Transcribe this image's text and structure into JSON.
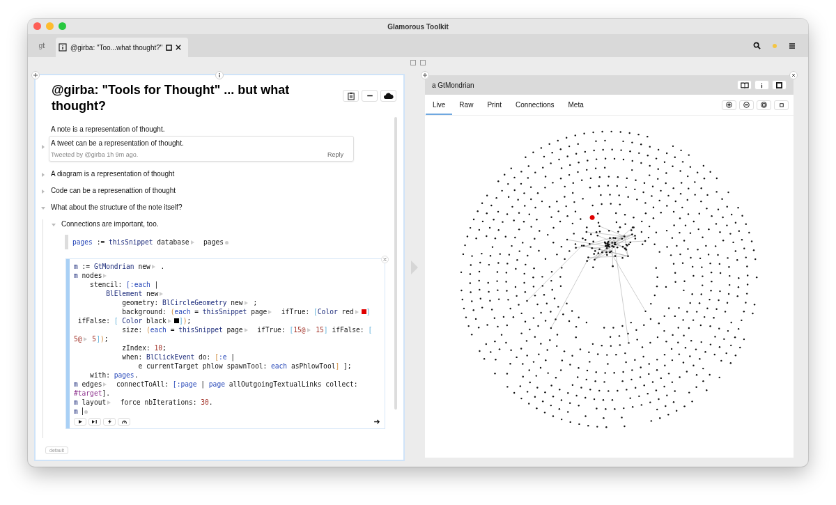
{
  "window": {
    "title": "Glamorous Toolkit"
  },
  "tabbar": {
    "logo": "g**t**",
    "tabs": [
      {
        "label": "@girba: \"Too...what thought?\"",
        "selected": true
      }
    ]
  },
  "note": {
    "title": "@girba: \"Tools for Thought\" ... but what thought?",
    "items": [
      {
        "kind": "text",
        "text": "A note is a representation of thought."
      },
      {
        "kind": "tweet",
        "text": "A tweet can be a representation of thought.",
        "meta": "Tweeted by @girba  1h 9m ago.",
        "action": "Reply",
        "expanded": false
      },
      {
        "kind": "text",
        "text": "A diagram is a representation of thought",
        "expanded": false
      },
      {
        "kind": "text",
        "text": "Code can be a represenattion of thought",
        "expanded": false
      },
      {
        "kind": "text",
        "text": "What about the structure of the note itself?",
        "expanded": true,
        "children": [
          {
            "kind": "text",
            "text": "Connections are important, too.",
            "expanded": true,
            "children": [
              {
                "kind": "code",
                "focused": false,
                "lines": [
                  [
                    {
                      "t": "pages",
                      "kind": "arg"
                    },
                    {
                      "t": " := ",
                      "kind": "plain"
                    },
                    {
                      "t": "thisSnippet",
                      "kind": "cls"
                    },
                    {
                      "t": " database",
                      "kind": "plain"
                    },
                    {
                      "kind": "exp"
                    },
                    {
                      "t": "  pages",
                      "kind": "plain"
                    },
                    {
                      "kind": "dot"
                    }
                  ]
                ]
              },
              {
                "kind": "code",
                "focused": true,
                "lines": [
                  [
                    {
                      "t": "m",
                      "kind": "cls"
                    },
                    {
                      "t": " := ",
                      "kind": "plain"
                    },
                    {
                      "t": "GtMondrian",
                      "kind": "cls"
                    },
                    {
                      "t": " new",
                      "kind": "plain"
                    },
                    {
                      "kind": "exp"
                    },
                    {
                      "t": " .",
                      "kind": "plain"
                    }
                  ],
                  [
                    {
                      "t": "m",
                      "kind": "cls"
                    },
                    {
                      "t": " nodes",
                      "kind": "plain"
                    },
                    {
                      "kind": "exp"
                    }
                  ],
                  [
                    {
                      "t": "    stencil: ",
                      "kind": "plain"
                    },
                    {
                      "t": "[:each",
                      "kind": "arg"
                    },
                    {
                      "t": " |",
                      "kind": "plain"
                    }
                  ],
                  [
                    {
                      "t": "        BlElement",
                      "kind": "cls"
                    },
                    {
                      "t": " new",
                      "kind": "plain"
                    },
                    {
                      "kind": "exp"
                    }
                  ],
                  [
                    {
                      "t": "            geometry: ",
                      "kind": "plain"
                    },
                    {
                      "t": "BlCircleGeometry",
                      "kind": "cls"
                    },
                    {
                      "t": " new",
                      "kind": "plain"
                    },
                    {
                      "kind": "exp"
                    },
                    {
                      "t": " ;",
                      "kind": "plain"
                    }
                  ],
                  [
                    {
                      "t": "            background: ",
                      "kind": "plain"
                    },
                    {
                      "t": "(",
                      "kind": "paren"
                    },
                    {
                      "t": "each",
                      "kind": "arg"
                    },
                    {
                      "t": " = ",
                      "kind": "plain"
                    },
                    {
                      "t": "thisSnippet",
                      "kind": "cls"
                    },
                    {
                      "t": " page",
                      "kind": "plain"
                    },
                    {
                      "kind": "exp"
                    },
                    {
                      "t": "  ifTrue: ",
                      "kind": "plain"
                    },
                    {
                      "t": "[",
                      "kind": "brack"
                    },
                    {
                      "t": "Color",
                      "kind": "cls"
                    },
                    {
                      "t": " red",
                      "kind": "plain"
                    },
                    {
                      "kind": "exp"
                    },
                    {
                      "kind": "swatch",
                      "color": "#e00000"
                    },
                    {
                      "t": "]",
                      "kind": "brack"
                    }
                  ],
                  [
                    {
                      "t": " ifFalse: ",
                      "kind": "plain"
                    },
                    {
                      "t": "[ ",
                      "kind": "brack"
                    },
                    {
                      "t": "Color",
                      "kind": "cls"
                    },
                    {
                      "t": " black",
                      "kind": "plain"
                    },
                    {
                      "kind": "exp"
                    },
                    {
                      "kind": "swatch",
                      "color": "#000000"
                    },
                    {
                      "t": "]",
                      "kind": "brack"
                    },
                    {
                      "t": ")",
                      "kind": "paren"
                    },
                    {
                      "t": ";",
                      "kind": "plain"
                    }
                  ],
                  [
                    {
                      "t": "            size: ",
                      "kind": "plain"
                    },
                    {
                      "t": "(",
                      "kind": "paren"
                    },
                    {
                      "t": "each",
                      "kind": "arg"
                    },
                    {
                      "t": " = ",
                      "kind": "plain"
                    },
                    {
                      "t": "thisSnippet",
                      "kind": "cls"
                    },
                    {
                      "t": " page",
                      "kind": "plain"
                    },
                    {
                      "kind": "exp"
                    },
                    {
                      "t": "  ifTrue: ",
                      "kind": "plain"
                    },
                    {
                      "t": "[",
                      "kind": "brack"
                    },
                    {
                      "t": "15@",
                      "kind": "num"
                    },
                    {
                      "kind": "exp"
                    },
                    {
                      "t": " 15",
                      "kind": "num"
                    },
                    {
                      "t": "]",
                      "kind": "brack"
                    },
                    {
                      "t": " ifFalse: ",
                      "kind": "plain"
                    },
                    {
                      "t": "[",
                      "kind": "brack"
                    }
                  ],
                  [
                    {
                      "t": "5@",
                      "kind": "num"
                    },
                    {
                      "kind": "exp"
                    },
                    {
                      "t": " 5",
                      "kind": "num"
                    },
                    {
                      "t": "]",
                      "kind": "brack"
                    },
                    {
                      "t": ")",
                      "kind": "paren"
                    },
                    {
                      "t": ";",
                      "kind": "plain"
                    }
                  ],
                  [
                    {
                      "t": "            zIndex: ",
                      "kind": "plain"
                    },
                    {
                      "t": "10",
                      "kind": "num"
                    },
                    {
                      "t": ";",
                      "kind": "plain"
                    }
                  ],
                  [
                    {
                      "t": "            when: ",
                      "kind": "plain"
                    },
                    {
                      "t": "BlClickEvent",
                      "kind": "cls"
                    },
                    {
                      "t": " do: ",
                      "kind": "plain"
                    },
                    {
                      "t": "[",
                      "kind": "paren"
                    },
                    {
                      "t": ":e",
                      "kind": "arg"
                    },
                    {
                      "t": " |",
                      "kind": "plain"
                    }
                  ],
                  [
                    {
                      "t": "                e currentTarget phlow spawnTool: ",
                      "kind": "plain"
                    },
                    {
                      "t": "each",
                      "kind": "arg"
                    },
                    {
                      "t": " asPhlowTool",
                      "kind": "plain"
                    },
                    {
                      "t": "]",
                      "kind": "paren"
                    },
                    {
                      "t": " ];",
                      "kind": "plain"
                    }
                  ],
                  [
                    {
                      "t": "    with: ",
                      "kind": "plain"
                    },
                    {
                      "t": "pages",
                      "kind": "arg"
                    },
                    {
                      "t": ".",
                      "kind": "plain"
                    }
                  ],
                  [
                    {
                      "t": "m",
                      "kind": "cls"
                    },
                    {
                      "t": " edges",
                      "kind": "plain"
                    },
                    {
                      "kind": "exp"
                    },
                    {
                      "t": "  connectToAll: ",
                      "kind": "plain"
                    },
                    {
                      "t": "[:page",
                      "kind": "arg"
                    },
                    {
                      "t": " | ",
                      "kind": "plain"
                    },
                    {
                      "t": "page",
                      "kind": "arg"
                    },
                    {
                      "t": " allOutgoingTextualLinks collect:",
                      "kind": "plain"
                    }
                  ],
                  [
                    {
                      "t": "#target",
                      "kind": "sym"
                    },
                    {
                      "t": "].",
                      "kind": "plain"
                    }
                  ],
                  [
                    {
                      "t": "m",
                      "kind": "cls"
                    },
                    {
                      "t": " layout",
                      "kind": "plain"
                    },
                    {
                      "kind": "exp"
                    },
                    {
                      "t": "  force nbIterations: ",
                      "kind": "plain"
                    },
                    {
                      "t": "30",
                      "kind": "num"
                    },
                    {
                      "t": ".",
                      "kind": "plain"
                    }
                  ],
                  [
                    {
                      "t": "m",
                      "kind": "cls"
                    },
                    {
                      "kind": "caret"
                    },
                    {
                      "kind": "dot"
                    }
                  ]
                ]
              }
            ]
          }
        ]
      }
    ],
    "footer": {
      "badge": "default"
    }
  },
  "inspector": {
    "title": "a GtMondrian",
    "tabs": [
      {
        "label": "Live",
        "selected": true
      },
      {
        "label": "Raw",
        "selected": false
      },
      {
        "label": "Print",
        "selected": false
      },
      {
        "label": "Connections",
        "selected": false
      },
      {
        "label": "Meta",
        "selected": false
      }
    ]
  }
}
